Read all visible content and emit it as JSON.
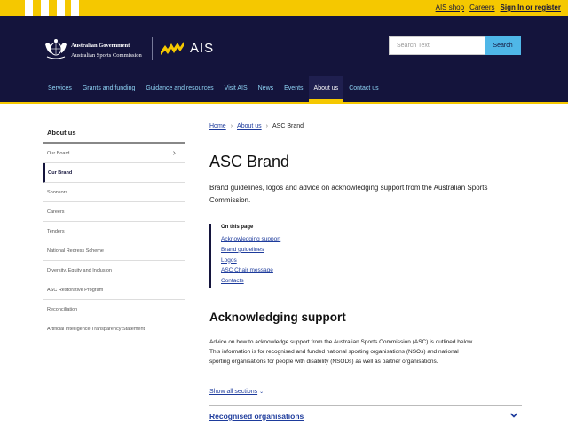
{
  "utility": {
    "links": [
      "AIS shop",
      "Careers",
      "Sign In or register"
    ]
  },
  "header": {
    "gov_line1": "Australian Government",
    "gov_line2": "Australian Sports Commission",
    "brand": "AIS",
    "search": {
      "placeholder": "Search Text",
      "button": "Search"
    },
    "nav": [
      "Services",
      "Grants and funding",
      "Guidance and resources",
      "Visit AIS",
      "News",
      "Events",
      "About us",
      "Contact us"
    ],
    "active_nav": "About us"
  },
  "sidenav": {
    "title": "About us",
    "items": [
      "Our Board",
      "Our Brand",
      "Sponsors",
      "Careers",
      "Tenders",
      "National Redress Scheme",
      "Diversity, Equity and Inclusion",
      "ASC Restorative Program",
      "Reconciliation",
      "Artificial Intelligence Transparency Statement"
    ],
    "active_item": "Our Brand"
  },
  "breadcrumb": {
    "home": "Home",
    "parent": "About us",
    "current": "ASC Brand"
  },
  "page": {
    "title": "ASC Brand",
    "intro": "Brand guidelines, logos and advice on acknowledging support from the Australian Sports Commission."
  },
  "on_this_page": {
    "title": "On this page",
    "links": [
      "Acknowledging support",
      "Brand guidelines",
      "Logos",
      "ASC Chair message",
      "Contacts"
    ]
  },
  "section": {
    "title": "Acknowledging support",
    "body": "Advice on how to acknowledge support from the Australian Sports Commission (ASC) is outlined below. This information is for recognised and funded national sporting organisations (NSOs) and national sporting organisations for people with disability (NSODs) as well as partner organisations."
  },
  "show_all": "Show all sections",
  "accordion": {
    "label": "Recognised organisations"
  },
  "colors": {
    "navy": "#14143c",
    "yellow": "#f5c800",
    "accent_blue": "#4fb7e8",
    "link": "#1d3b9c"
  }
}
